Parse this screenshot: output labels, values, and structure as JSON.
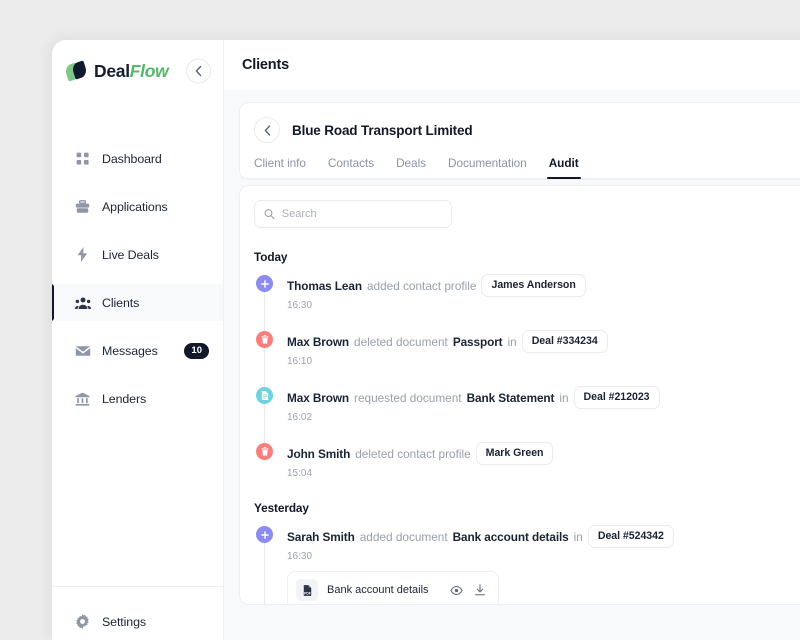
{
  "brand": {
    "name_part1": "Deal",
    "name_part2": "Flow",
    "logo_icon": "leaf-logo",
    "accent_green": "#55b76a",
    "dark": "#151d2e"
  },
  "sidebar": {
    "collapse_icon": "chevron-left-icon",
    "items": [
      {
        "label": "Dashboard",
        "icon": "grid-icon",
        "active": false
      },
      {
        "label": "Applications",
        "icon": "briefcase-icon",
        "active": false
      },
      {
        "label": "Live Deals",
        "icon": "lightning-icon",
        "active": false
      },
      {
        "label": "Clients",
        "icon": "users-icon",
        "active": true
      },
      {
        "label": "Messages",
        "icon": "envelope-icon",
        "active": false,
        "badge": "10"
      },
      {
        "label": "Lenders",
        "icon": "bank-icon",
        "active": false
      }
    ],
    "footer": {
      "label": "Settings",
      "icon": "gear-icon"
    }
  },
  "header": {
    "title": "Clients"
  },
  "client": {
    "back_icon": "chevron-left-icon",
    "name": "Blue Road Transport Limited",
    "tabs": [
      {
        "label": "Client info",
        "active": false
      },
      {
        "label": "Contacts",
        "active": false
      },
      {
        "label": "Deals",
        "active": false
      },
      {
        "label": "Documentation",
        "active": false
      },
      {
        "label": "Audit",
        "active": true
      }
    ]
  },
  "search": {
    "icon": "search-icon",
    "value": "",
    "placeholder": "Search"
  },
  "audit": {
    "sections": [
      {
        "label": "Today",
        "events": [
          {
            "dot_icon": "plus-icon",
            "dot_color": "#8b8bf0",
            "actor": "Thomas Lean",
            "action": "added contact profile",
            "subject": "",
            "connector": "",
            "chip": "James Anderson",
            "time": "16:30"
          },
          {
            "dot_icon": "trash-icon",
            "dot_color": "#fb7e7e",
            "actor": "Max Brown",
            "action": "deleted document",
            "subject": "Passport",
            "connector": "in",
            "chip": "Deal #334234",
            "time": "16:10"
          },
          {
            "dot_icon": "document-icon",
            "dot_color": "#6ed3dd",
            "actor": "Max Brown",
            "action": "requested document",
            "subject": "Bank Statement",
            "connector": "in",
            "chip": "Deal #212023",
            "time": "16:02"
          },
          {
            "dot_icon": "trash-icon",
            "dot_color": "#fb7e7e",
            "actor": "John Smith",
            "action": "deleted contact profile",
            "subject": "",
            "connector": "",
            "chip": "Mark Green",
            "time": "15:04"
          }
        ]
      },
      {
        "label": "Yesterday",
        "events": [
          {
            "dot_icon": "plus-icon",
            "dot_color": "#8b8bf0",
            "actor": "Sarah Smith",
            "action": "added document",
            "subject": "Bank account details",
            "connector": "in",
            "chip": "Deal #524342",
            "time": "16:30",
            "attachment": {
              "file_icon": "pdf-file-icon",
              "name": "Bank account details",
              "preview_icon": "eye-icon",
              "download_icon": "download-icon"
            }
          }
        ]
      }
    ]
  }
}
